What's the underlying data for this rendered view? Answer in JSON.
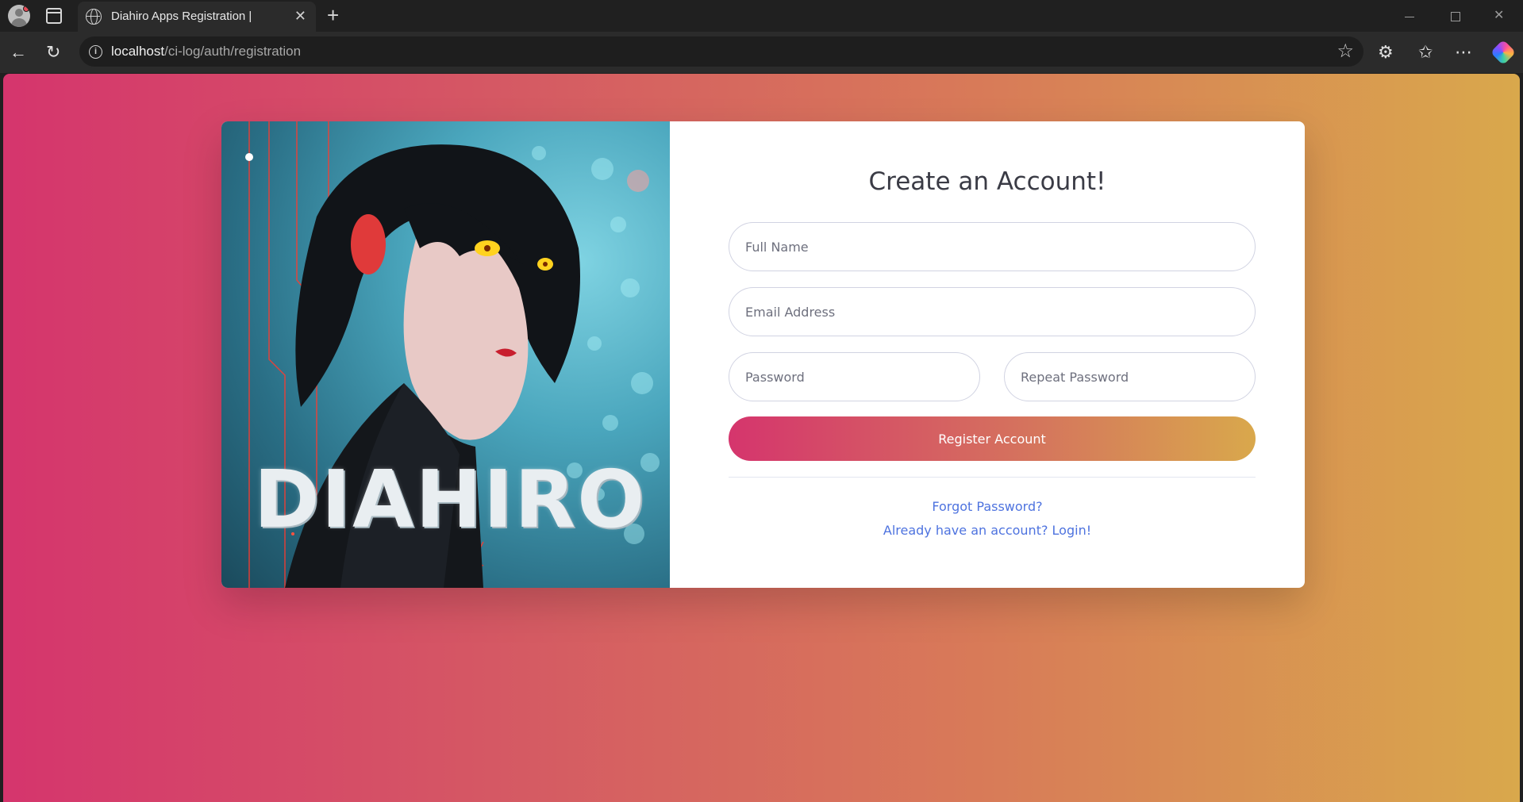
{
  "browser": {
    "tab_title": "Diahiro Apps Registration |",
    "tab_close": "✕",
    "new_tab": "+",
    "url_host": "localhost",
    "url_path": "/ci-log/auth/registration",
    "window_close": "✕"
  },
  "hero": {
    "brand_text": "DIAHIRO"
  },
  "form": {
    "heading": "Create an Account!",
    "full_name_placeholder": "Full Name",
    "email_placeholder": "Email Address",
    "password_placeholder": "Password",
    "repeat_password_placeholder": "Repeat Password",
    "register_label": "Register Account",
    "forgot_label": "Forgot Password?",
    "login_label": "Already have an account? Login!"
  },
  "colors": {
    "gradient_start": "#d5356d",
    "gradient_end": "#d9a84c",
    "link": "#4e73df",
    "heading": "#3a3b45"
  }
}
